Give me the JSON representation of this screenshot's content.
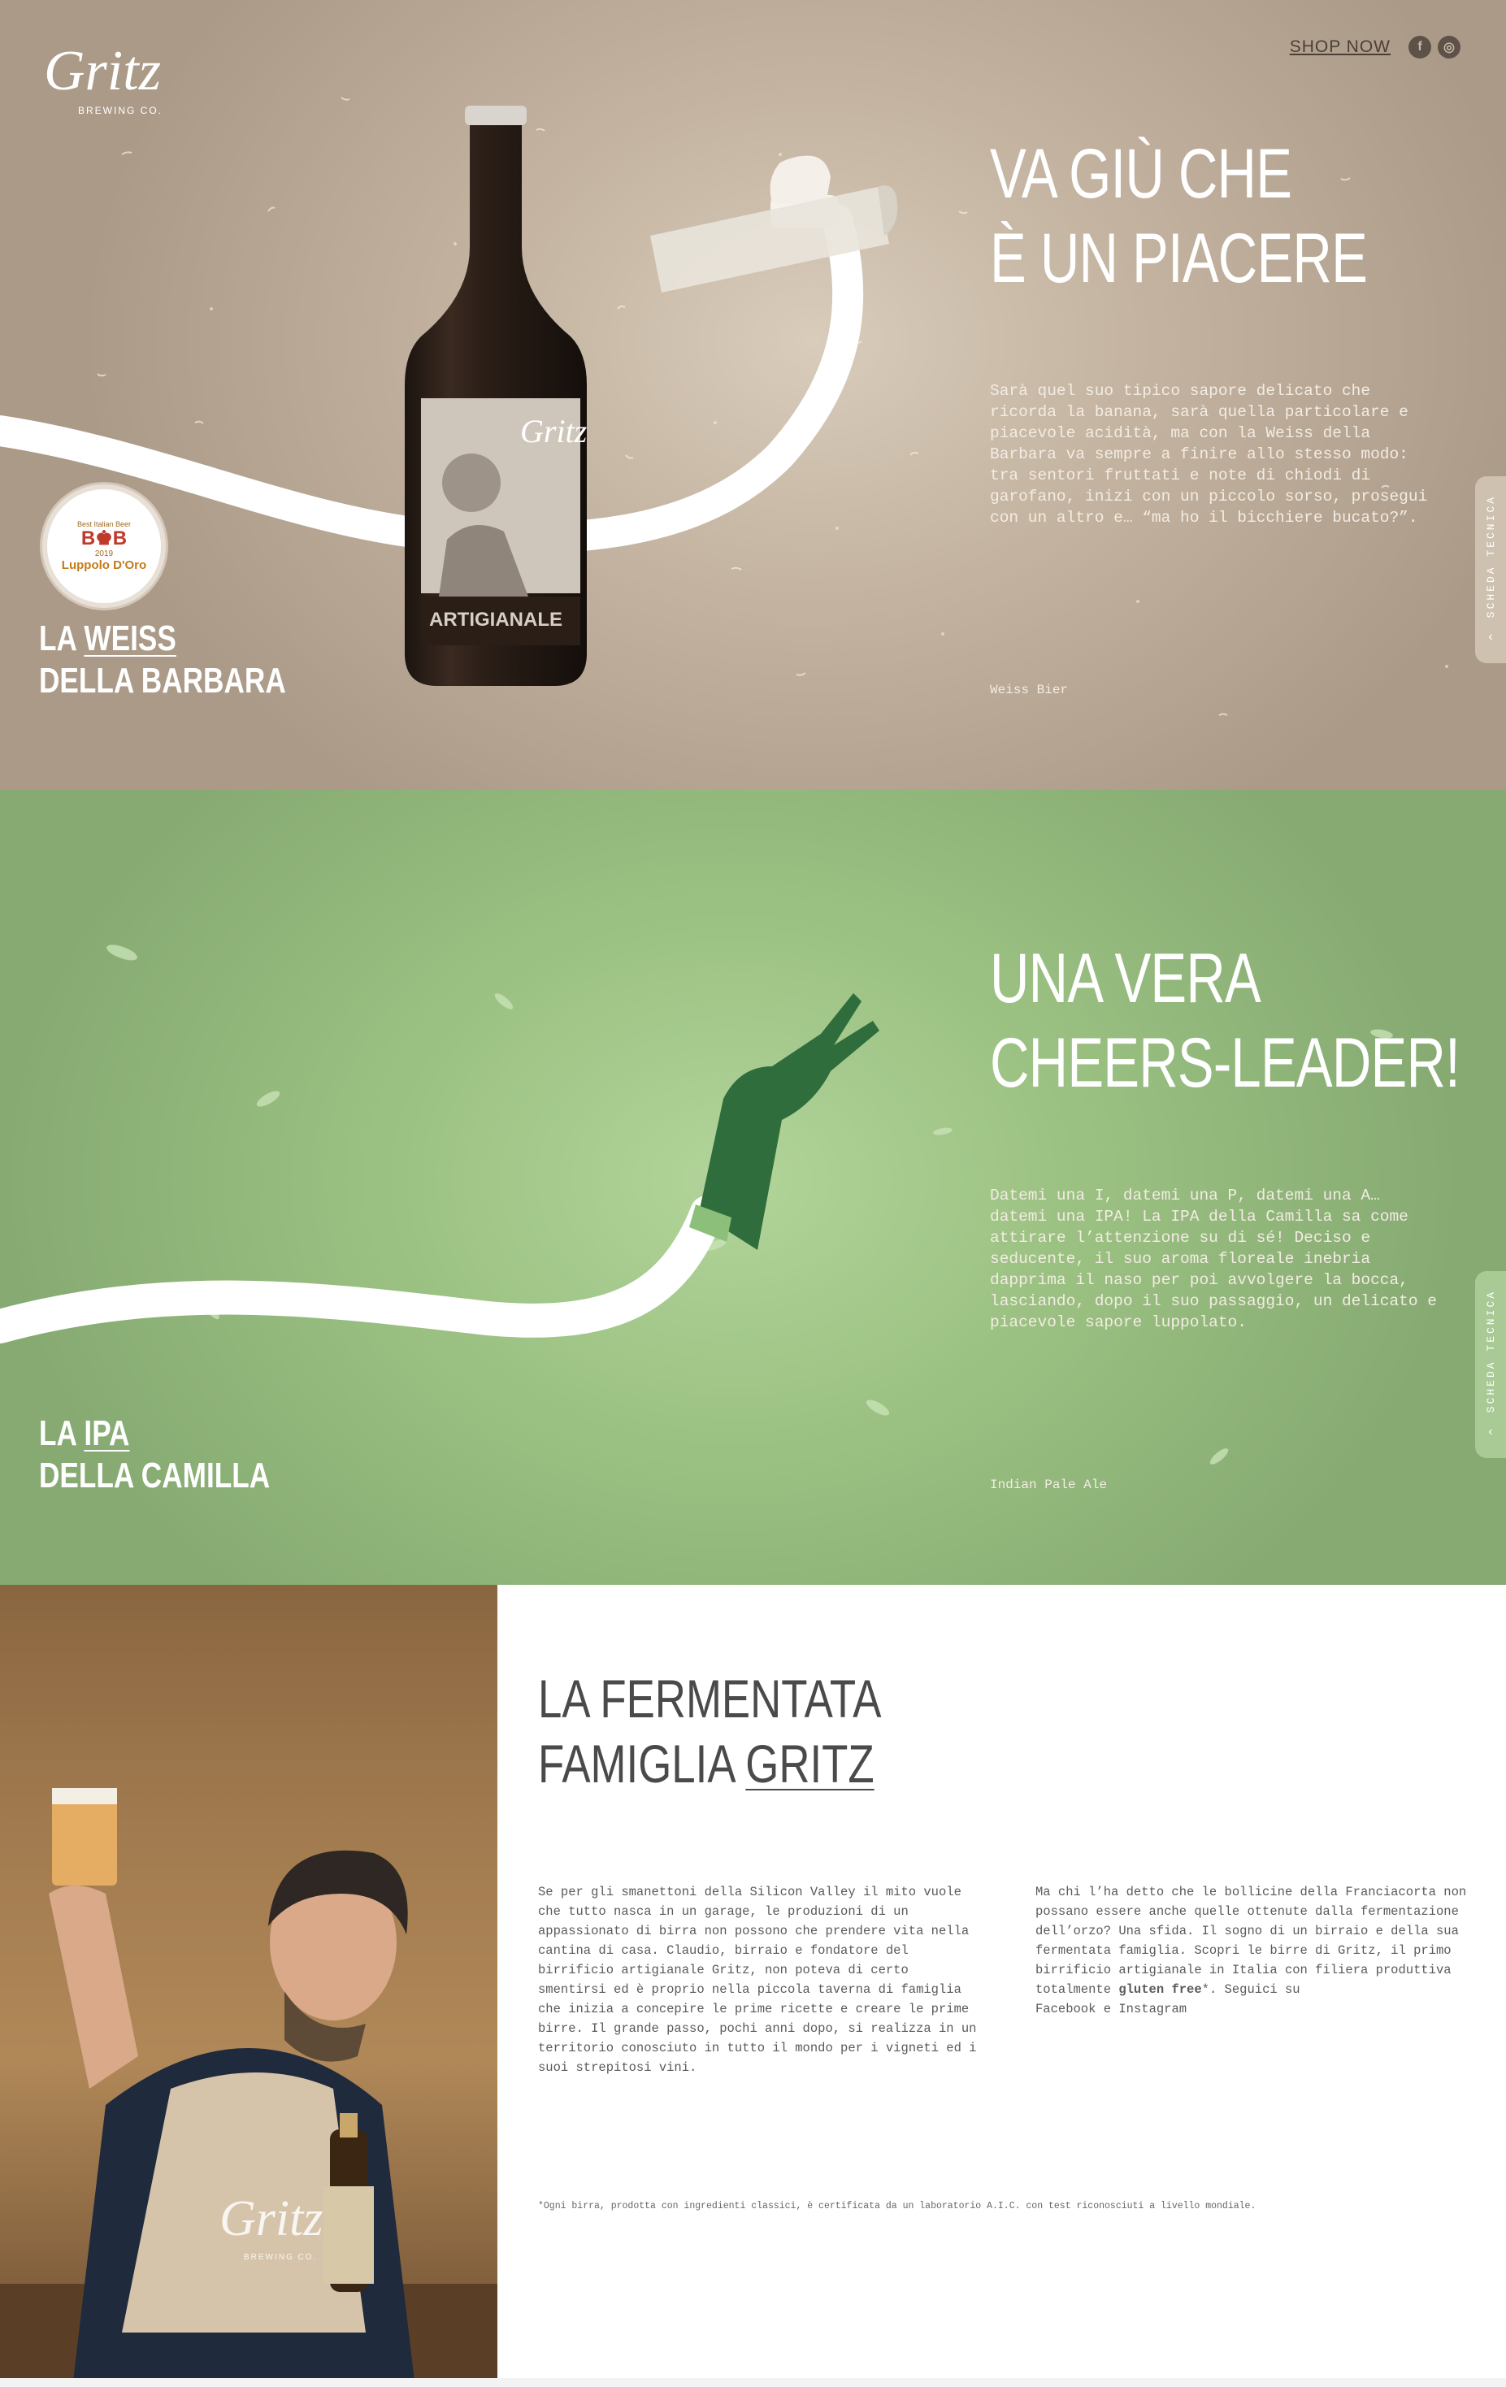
{
  "header": {
    "logo_text": "Gritz",
    "logo_sub": "BREWING CO.",
    "shop_label": "SHOP NOW",
    "social": [
      {
        "icon": "facebook-icon",
        "glyph": "f"
      },
      {
        "icon": "instagram-icon",
        "glyph": "◎"
      }
    ]
  },
  "weiss": {
    "headline_1": "VA GIÙ CHE",
    "headline_2": "È UN PIACERE",
    "body": "Sarà quel suo tipico sapore delicato che ricorda la banana, sarà quella particolare e piacevole acidità, ma con la Weiss della Barbara va sempre a finire allo stesso modo: tra sentori fruttati e note di chiodi di garofano, inizi con un piccolo sorso, prosegui con un altro e… “ma ho il bicchiere bucato?”.",
    "style": "Weiss Bier",
    "name_prefix": "LA",
    "name_link": "WEISS",
    "name_line2": "DELLA BARBARA",
    "side_tab": "SCHEDA TECNICA",
    "award": {
      "line1": "Best Italian Beer",
      "logo": "B♚B",
      "year": "2019",
      "name": "Luppolo D'Oro"
    },
    "bottle_label": "LA WEISS DELLA BARBARA",
    "bottle_band": "ARTIGIANALE"
  },
  "ipa": {
    "headline_1": "UNA VERA",
    "headline_2": "CHEERS-LEADER!",
    "body": "Datemi una I, datemi una P, datemi una A… datemi una IPA! La IPA della Camilla sa come attirare l’attenzione su di sé! Deciso e seducente, il suo aroma floreale inebria dapprima il naso per poi avvolgere la bocca, lasciando, dopo il suo passaggio, un delicato e piacevole sapore luppolato.",
    "style": "Indian Pale Ale",
    "name_prefix": "LA",
    "name_link": "IPA",
    "name_line2": "DELLA CAMILLA",
    "side_tab": "SCHEDA TECNICA"
  },
  "famiglia": {
    "title_1": "LA FERMENTATA",
    "title_2_prefix": "FAMIGLIA",
    "title_2_link": "GRITZ",
    "col1": "Se per gli smanettoni della Silicon Valley il mito vuole che tutto nasca in un garage, le produzioni di un appassionato di birra non possono che prendere vita nella cantina di casa. Claudio, birraio e fondatore del birrificio artigianale Gritz, non poteva di certo smentirsi ed è proprio nella piccola taverna di famiglia che inizia a concepire le prime ricette e creare le prime birre. Il grande passo, pochi anni dopo, si realizza in un territorio conosciuto in tutto il mondo per i vigneti ed i suoi strepitosi vini.",
    "col2_text": "Ma chi l’ha detto che le bollicine della Franciacorta non possano essere anche quelle ottenute dalla fermentazione dell’orzo? Una sfida. Il sogno di un birraio e della sua fermentata famiglia. Scopri le birre di Gritz, il primo birrificio artigianale in Italia con filiera produttiva totalmente",
    "col2_bold": "gluten free",
    "col2_after": "*. Seguici su",
    "link_facebook": "Facebook",
    "and": "e",
    "link_instagram": "Instagram",
    "footnote": "*Ogni birra, prodotta con ingredienti classici, è certificata da un laboratorio A.I.C. con test riconosciuti a livello mondiale.",
    "apron_text": "Gritz",
    "apron_sub": "BREWING CO."
  },
  "colors": {
    "weiss_bg": "#c3b3a0",
    "ipa_bg": "#9cc283",
    "glove_green": "#2f6e3c"
  }
}
